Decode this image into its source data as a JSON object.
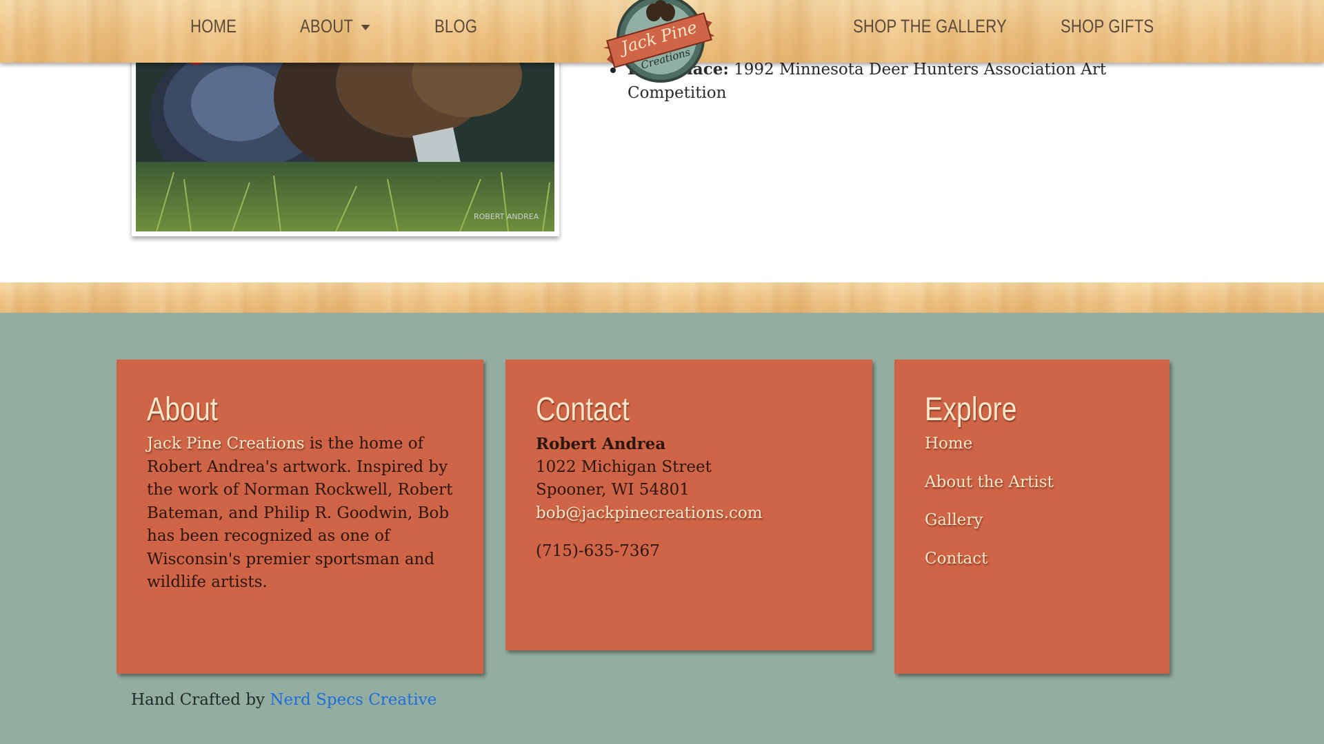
{
  "header": {
    "nav": {
      "home": "HOME",
      "about": "ABOUT",
      "blog": "BLOG",
      "shop_gallery": "SHOP THE GALLERY",
      "shop_gifts": "SHOP GIFTS"
    },
    "logo": {
      "line1": "Jack Pine",
      "line2": "Creations"
    }
  },
  "awards": {
    "item1_bold": "First Place:",
    "item1_rest": " 1992 Minnesota Deer Hunters Association Art Competition"
  },
  "painting": {
    "signature": "ROBERT ANDREA",
    "alt": "wild-turkey-painting"
  },
  "footer": {
    "about": {
      "heading": "About",
      "link": "Jack Pine Creations",
      "text": " is the home of Robert Andrea's artwork. Inspired by the work of Norman Rockwell, Robert Bateman, and Philip R. Goodwin, Bob has been recognized as one of Wisconsin's premier sportsman and wildlife artists."
    },
    "contact": {
      "heading": "Contact",
      "name": "Robert Andrea",
      "street": "1022 Michigan Street",
      "city": "Spooner, WI 54801",
      "email": "bob@jackpinecreations.com",
      "phone": "(715)-635-7367"
    },
    "explore": {
      "heading": "Explore",
      "links": [
        "Home",
        "About the Artist",
        "Gallery",
        "Contact"
      ]
    },
    "credit": {
      "prefix": "Hand Crafted by ",
      "link": "Nerd Specs Creative"
    }
  },
  "colors": {
    "card": "#cf6446",
    "footer_bg": "#94ada1",
    "heading_cream": "#f7e6c9",
    "credit_link": "#1e6fd9",
    "nav_text": "#5b4a3a"
  }
}
